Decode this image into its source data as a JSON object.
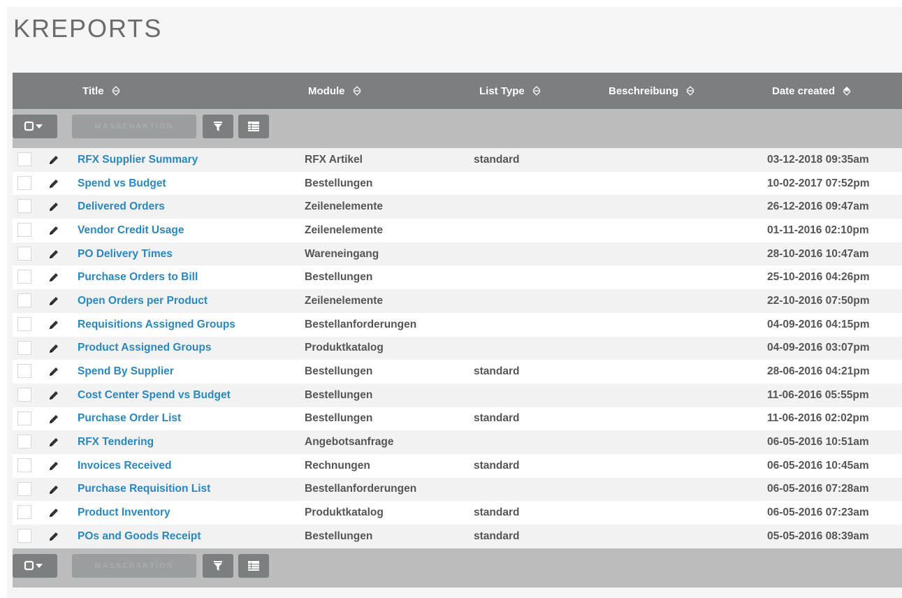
{
  "page": {
    "title": "KREPORTS"
  },
  "columns": {
    "title": "Title",
    "module": "Module",
    "list_type": "List Type",
    "beschreibung": "Beschreibung",
    "date_created": "Date created"
  },
  "actions": {
    "mass_action_label": "MASSENAKTION",
    "select_icon": "checkbox-dropdown-icon",
    "filter_icon": "filter-icon",
    "columns_icon": "column-list-icon"
  },
  "colors": {
    "header": "#7b7f7f",
    "actionbar": "#bcbcbc",
    "link": "#2a87c0",
    "text": "#555555"
  },
  "rows": [
    {
      "title": "RFX Supplier Summary",
      "module": "RFX Artikel",
      "list_type": "standard",
      "beschreibung": "",
      "date_created": "03-12-2018 09:35am"
    },
    {
      "title": "Spend vs Budget",
      "module": "Bestellungen",
      "list_type": "",
      "beschreibung": "",
      "date_created": "10-02-2017 07:52pm"
    },
    {
      "title": "Delivered Orders",
      "module": "Zeilenelemente",
      "list_type": "",
      "beschreibung": "",
      "date_created": "26-12-2016 09:47am"
    },
    {
      "title": "Vendor Credit Usage",
      "module": "Zeilenelemente",
      "list_type": "",
      "beschreibung": "",
      "date_created": "01-11-2016 02:10pm"
    },
    {
      "title": "PO Delivery Times",
      "module": "Wareneingang",
      "list_type": "",
      "beschreibung": "",
      "date_created": "28-10-2016 10:47am"
    },
    {
      "title": "Purchase Orders to Bill",
      "module": "Bestellungen",
      "list_type": "",
      "beschreibung": "",
      "date_created": "25-10-2016 04:26pm"
    },
    {
      "title": "Open Orders per Product",
      "module": "Zeilenelemente",
      "list_type": "",
      "beschreibung": "",
      "date_created": "22-10-2016 07:50pm"
    },
    {
      "title": "Requisitions Assigned Groups",
      "module": "Bestellanforderungen",
      "list_type": "",
      "beschreibung": "",
      "date_created": "04-09-2016 04:15pm"
    },
    {
      "title": "Product Assigned Groups",
      "module": "Produktkatalog",
      "list_type": "",
      "beschreibung": "",
      "date_created": "04-09-2016 03:07pm"
    },
    {
      "title": "Spend By Supplier",
      "module": "Bestellungen",
      "list_type": "standard",
      "beschreibung": "",
      "date_created": "28-06-2016 04:21pm"
    },
    {
      "title": "Cost Center Spend vs Budget",
      "module": "Bestellungen",
      "list_type": "",
      "beschreibung": "",
      "date_created": "11-06-2016 05:55pm"
    },
    {
      "title": "Purchase Order List",
      "module": "Bestellungen",
      "list_type": "standard",
      "beschreibung": "",
      "date_created": "11-06-2016 02:02pm"
    },
    {
      "title": "RFX Tendering",
      "module": "Angebotsanfrage",
      "list_type": "",
      "beschreibung": "",
      "date_created": "06-05-2016 10:51am"
    },
    {
      "title": "Invoices Received",
      "module": "Rechnungen",
      "list_type": "standard",
      "beschreibung": "",
      "date_created": "06-05-2016 10:45am"
    },
    {
      "title": "Purchase Requisition List",
      "module": "Bestellanforderungen",
      "list_type": "",
      "beschreibung": "",
      "date_created": "06-05-2016 07:28am"
    },
    {
      "title": "Product Inventory",
      "module": "Produktkatalog",
      "list_type": "standard",
      "beschreibung": "",
      "date_created": "06-05-2016 07:23am"
    },
    {
      "title": "POs and Goods Receipt",
      "module": "Bestellungen",
      "list_type": "standard",
      "beschreibung": "",
      "date_created": "05-05-2016 08:39am"
    }
  ]
}
